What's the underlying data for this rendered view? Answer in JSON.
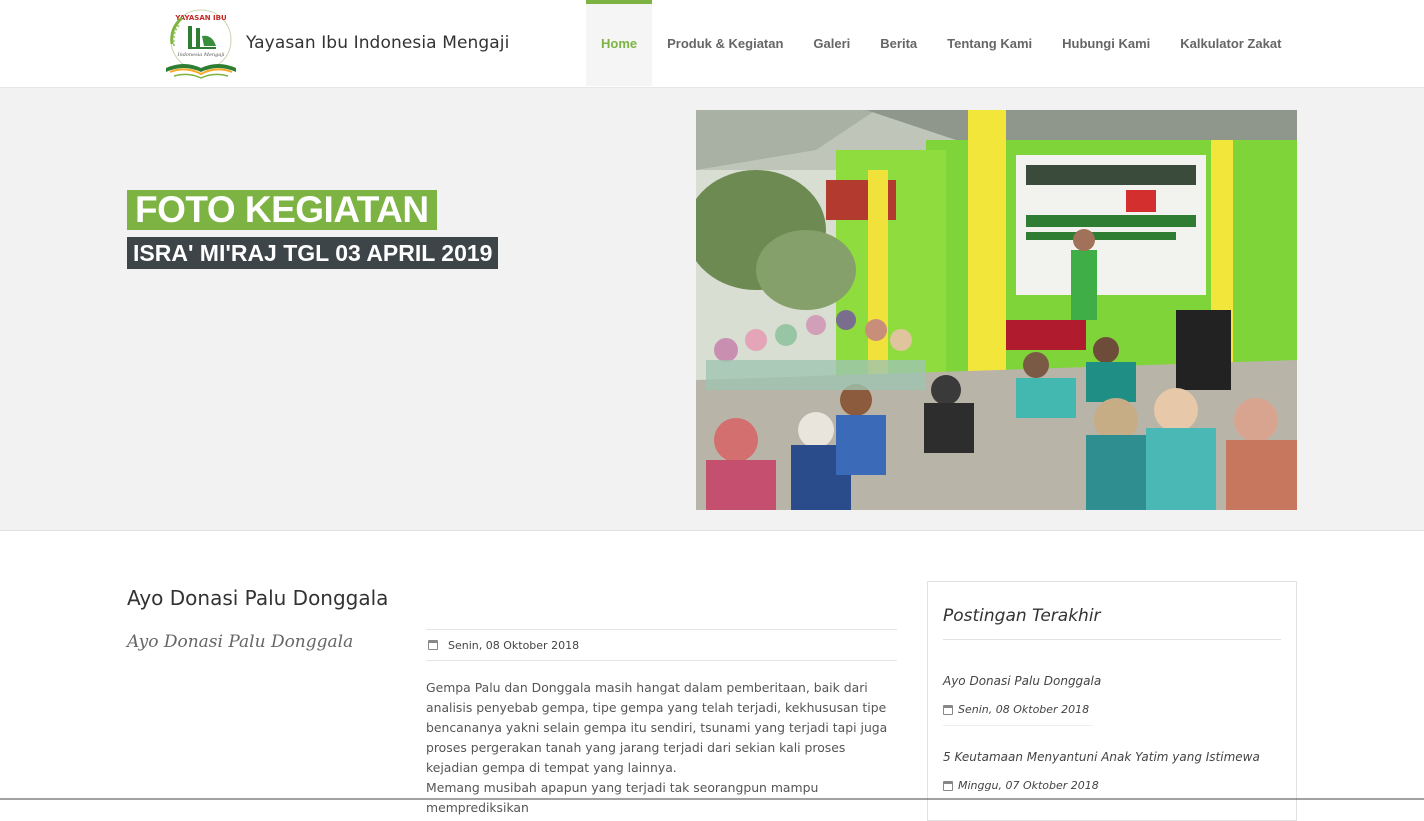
{
  "site": {
    "brand": "Yayasan Ibu Indonesia Mengaji",
    "logo_text": "YAYASAN IBU"
  },
  "nav": {
    "items": [
      {
        "label": "Home",
        "active": true
      },
      {
        "label": "Produk & Kegiatan",
        "active": false
      },
      {
        "label": "Galeri",
        "active": false
      },
      {
        "label": "Berita",
        "active": false
      },
      {
        "label": "Tentang Kami",
        "active": false
      },
      {
        "label": "Hubungi Kami",
        "active": false
      },
      {
        "label": "Kalkulator Zakat",
        "active": false
      }
    ]
  },
  "hero": {
    "title": "FOTO KEGIATAN",
    "subtitle": "ISRA' MI'RAJ TGL 03 APRIL 2019"
  },
  "post": {
    "title": "Ayo Donasi Palu Donggala",
    "subtitle": "Ayo Donasi Palu Donggala",
    "date": "Senin, 08 Oktober 2018",
    "paragraphs": [
      "Gempa Palu dan Donggala masih hangat dalam pemberitaan, baik dari analisis penyebab gempa, tipe gempa yang telah terjadi, kekhususan tipe bencananya yakni selain gempa itu sendiri, tsunami yang terjadi tapi juga proses pergerakan tanah yang jarang terjadi dari sekian kali proses kejadian gempa di tempat yang lainnya.",
      "Memang musibah apapun yang terjadi tak seorangpun mampu memprediksikan"
    ]
  },
  "sidebar": {
    "title": "Postingan Terakhir",
    "posts": [
      {
        "title": "Ayo Donasi Palu Donggala",
        "date": "Senin, 08 Oktober 2018"
      },
      {
        "title": "5 Keutamaan Menyantuni Anak Yatim yang Istimewa",
        "date": "Minggu, 07 Oktober 2018"
      }
    ]
  },
  "colors": {
    "accent": "#7cb342",
    "dark_label": "#3e4549",
    "hero_bg": "#f2f2f2"
  }
}
